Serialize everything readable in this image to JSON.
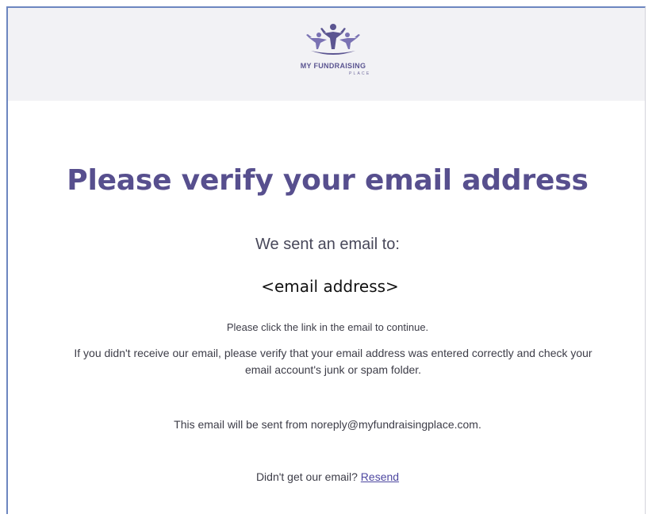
{
  "header": {
    "logo_line1": "MY FUNDRAISING",
    "logo_line2": "PLACE",
    "logo_icon": "people-celebrating-logo-icon"
  },
  "main": {
    "title": "Please verify your email address",
    "sent_to": "We sent an email to:",
    "email_placeholder": "<email address>",
    "instructions": "Please click the link in the email to continue.",
    "help_text": "If you didn't receive our email, please verify that your email address was entered correctly and check your email account's junk or spam folder.",
    "sender_note": "This email will be sent from noreply@myfundraisingplace.com.",
    "resend_prompt": "Didn't get our email?",
    "resend_link": "Resend"
  },
  "colors": {
    "brand_purple": "#574f8e",
    "logo_purple": "#5b5591",
    "header_bg": "#f2f2f5",
    "link": "#4d47a0"
  }
}
